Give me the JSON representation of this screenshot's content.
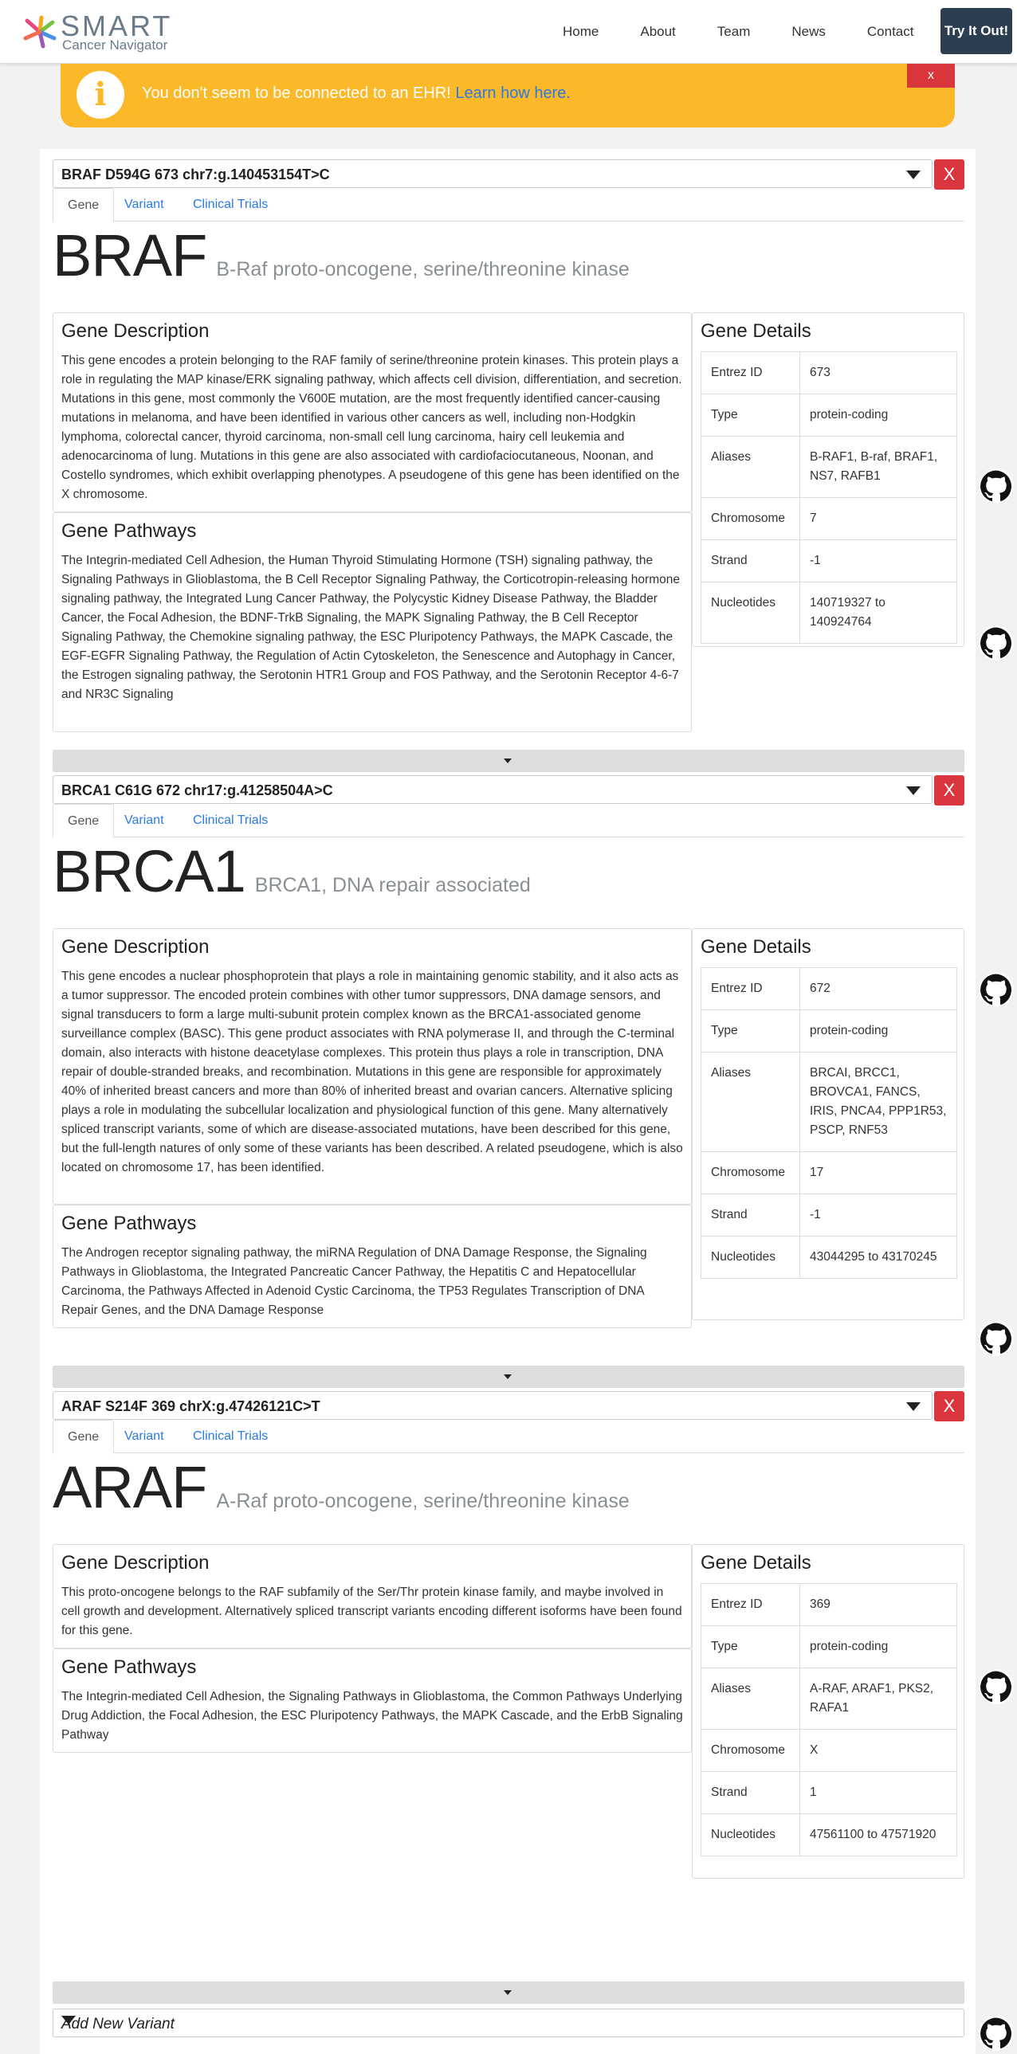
{
  "brand": {
    "title": "SMART",
    "subtitle": "Cancer Navigator"
  },
  "nav": {
    "links": [
      "Home",
      "About",
      "Team",
      "News",
      "Contact"
    ],
    "cta": "Try It Out!"
  },
  "alert": {
    "message": "You don't seem to be connected to an EHR!",
    "link": "Learn how here.",
    "close": "x"
  },
  "tabs": [
    "Gene",
    "Variant",
    "Clinical Trials"
  ],
  "labels": {
    "description": "Gene Description",
    "pathways": "Gene Pathways",
    "details": "Gene Details",
    "entrez": "Entrez ID",
    "type": "Type",
    "aliases": "Aliases",
    "chromosome": "Chromosome",
    "strand": "Strand",
    "nucleotides": "Nucleotides",
    "remove": "X"
  },
  "variants": [
    {
      "select": "BRAF D594G 673 chr7:g.140453154T>C",
      "symbol": "BRAF",
      "name": "B-Raf proto-oncogene, serine/threonine kinase",
      "description": "This gene encodes a protein belonging to the RAF family of serine/threonine protein kinases. This protein plays a role in regulating the MAP kinase/ERK signaling pathway, which affects cell division, differentiation, and secretion. Mutations in this gene, most commonly the V600E mutation, are the most frequently identified cancer-causing mutations in melanoma, and have been identified in various other cancers as well, including non-Hodgkin lymphoma, colorectal cancer, thyroid carcinoma, non-small cell lung carcinoma, hairy cell leukemia and adenocarcinoma of lung. Mutations in this gene are also associated with cardiofaciocutaneous, Noonan, and Costello syndromes, which exhibit overlapping phenotypes. A pseudogene of this gene has been identified on the X chromosome.",
      "pathways": "The Integrin-mediated Cell Adhesion, the Human Thyroid Stimulating Hormone (TSH) signaling pathway, the Signaling Pathways in Glioblastoma, the B Cell Receptor Signaling Pathway, the Corticotropin-releasing hormone signaling pathway, the Integrated Lung Cancer Pathway, the Polycystic Kidney Disease Pathway, the Bladder Cancer, the Focal Adhesion, the BDNF-TrkB Signaling, the MAPK Signaling Pathway, the B Cell Receptor Signaling Pathway, the Chemokine signaling pathway, the ESC Pluripotency Pathways, the MAPK Cascade, the EGF-EGFR Signaling Pathway, the Regulation of Actin Cytoskeleton, the Senescence and Autophagy in Cancer, the Estrogen signaling pathway, the Serotonin HTR1 Group and FOS Pathway, and the Serotonin Receptor 4-6-7 and NR3C Signaling",
      "entrez": "673",
      "type": "protein-coding",
      "aliases": "B-RAF1, B-raf, BRAF1, NS7, RAFB1",
      "chromosome": "7",
      "strand": "-1",
      "nucleotides": "140719327 to 140924764"
    },
    {
      "select": "BRCA1 C61G 672 chr17:g.41258504A>C",
      "symbol": "BRCA1",
      "name": "BRCA1, DNA repair associated",
      "description": "This gene encodes a nuclear phosphoprotein that plays a role in maintaining genomic stability, and it also acts as a tumor suppressor. The encoded protein combines with other tumor suppressors, DNA damage sensors, and signal transducers to form a large multi-subunit protein complex known as the BRCA1-associated genome surveillance complex (BASC). This gene product associates with RNA polymerase II, and through the C-terminal domain, also interacts with histone deacetylase complexes. This protein thus plays a role in transcription, DNA repair of double-stranded breaks, and recombination. Mutations in this gene are responsible for approximately 40% of inherited breast cancers and more than 80% of inherited breast and ovarian cancers. Alternative splicing plays a role in modulating the subcellular localization and physiological function of this gene. Many alternatively spliced transcript variants, some of which are disease-associated mutations, have been described for this gene, but the full-length natures of only some of these variants has been described. A related pseudogene, which is also located on chromosome 17, has been identified.",
      "pathways": "The Androgen receptor signaling pathway, the miRNA Regulation of DNA Damage Response, the Signaling Pathways in Glioblastoma, the Integrated Pancreatic Cancer Pathway, the Hepatitis C and Hepatocellular Carcinoma, the Pathways Affected in Adenoid Cystic Carcinoma, the TP53 Regulates Transcription of DNA Repair Genes, and the DNA Damage Response",
      "entrez": "672",
      "type": "protein-coding",
      "aliases": "BRCAI, BRCC1, BROVCA1, FANCS, IRIS, PNCA4, PPP1R53, PSCP, RNF53",
      "chromosome": "17",
      "strand": "-1",
      "nucleotides": "43044295 to 43170245"
    },
    {
      "select": "ARAF S214F 369 chrX:g.47426121C>T",
      "symbol": "ARAF",
      "name": "A-Raf proto-oncogene, serine/threonine kinase",
      "description": "This proto-oncogene belongs to the RAF subfamily of the Ser/Thr protein kinase family, and maybe involved in cell growth and development. Alternatively spliced transcript variants encoding different isoforms have been found for this gene.",
      "pathways": "The Integrin-mediated Cell Adhesion, the Signaling Pathways in Glioblastoma, the Common Pathways Underlying Drug Addiction, the Focal Adhesion, the ESC Pluripotency Pathways, the MAPK Cascade, and the ErbB Signaling Pathway",
      "entrez": "369",
      "type": "protein-coding",
      "aliases": "A-RAF, ARAF1, PKS2, RAFA1",
      "chromosome": "X",
      "strand": "1",
      "nucleotides": "47561100 to 47571920"
    }
  ],
  "add_variant": "Add New Variant",
  "icons": [
    "smart-logo-icon",
    "info-icon",
    "github-icon",
    "caret-down-icon"
  ]
}
